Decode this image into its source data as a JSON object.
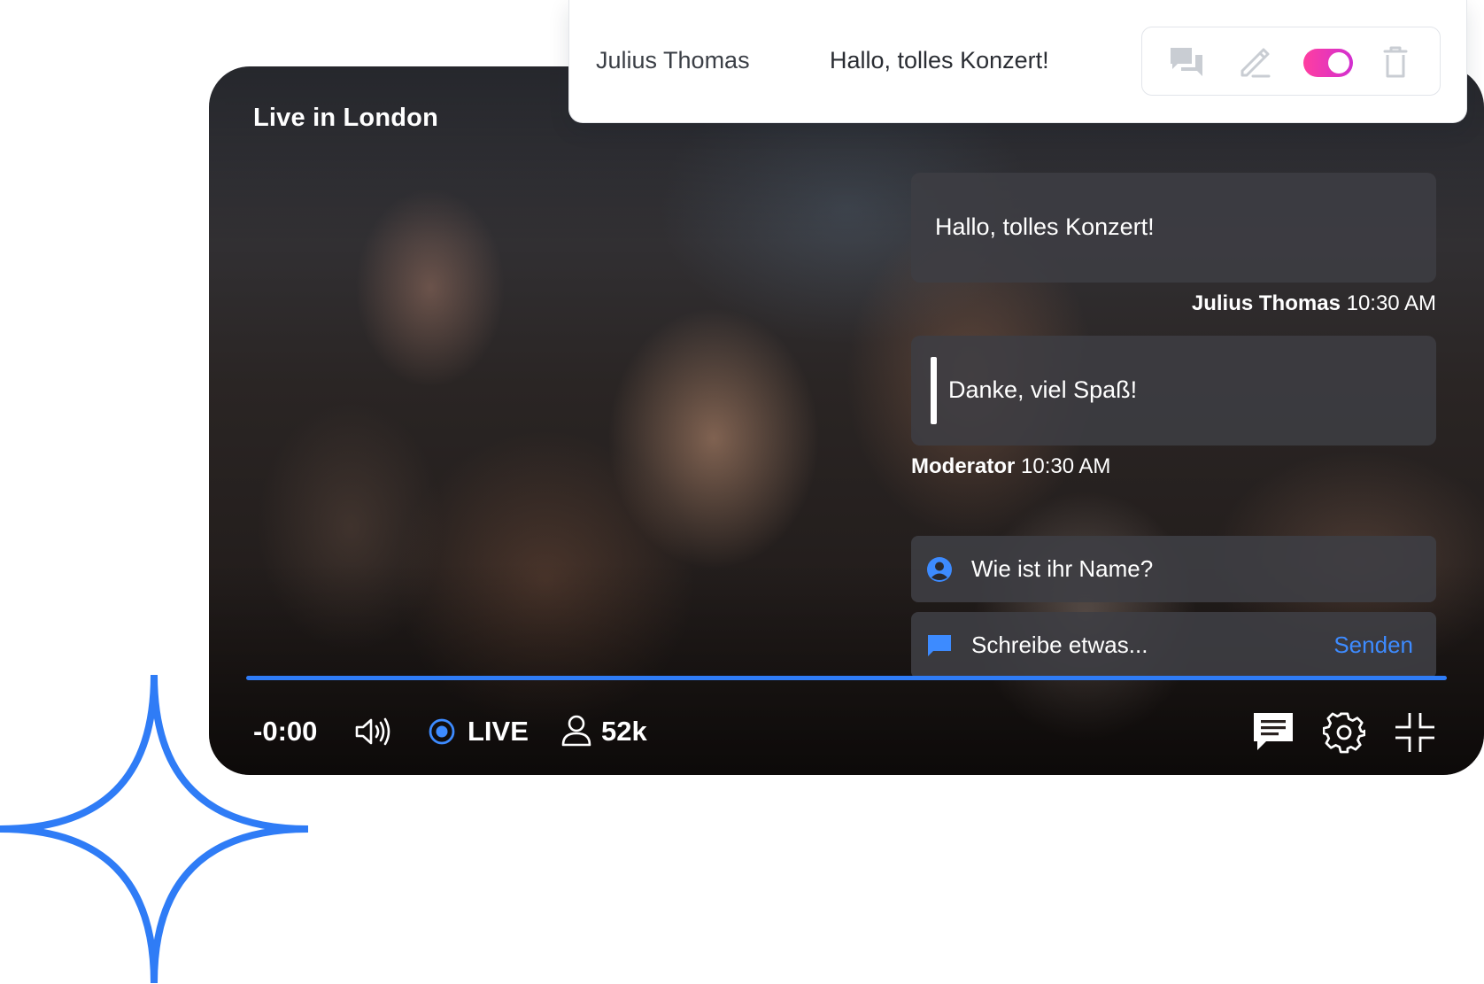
{
  "moderation": {
    "user": "Julius Thomas",
    "message": "Hallo, tolles Konzert!",
    "toggle_on": true
  },
  "video": {
    "title": "Live in London"
  },
  "chat": {
    "messages": [
      {
        "text": "Hallo, tolles Konzert!",
        "author": "Julius Thomas",
        "time": "10:30 AM"
      },
      {
        "text": "Danke, viel Spaß!",
        "author": "Moderator",
        "time": "10:30 AM"
      }
    ],
    "name_placeholder": "Wie ist ihr Name?",
    "message_placeholder": "Schreibe etwas...",
    "send_label": "Senden"
  },
  "controls": {
    "time": "-0:00",
    "live_label": "LIVE",
    "viewers": "52k",
    "progress_fraction": 1.0
  },
  "colors": {
    "accent": "#2f7cf6",
    "toggle": "#e935b8"
  }
}
